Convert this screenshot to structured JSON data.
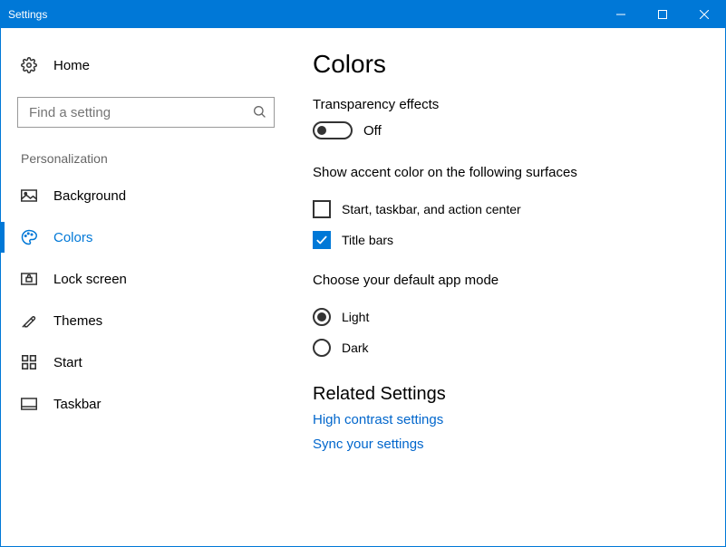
{
  "window": {
    "title": "Settings"
  },
  "sidebar": {
    "home_label": "Home",
    "search_placeholder": "Find a setting",
    "section_label": "Personalization",
    "items": [
      {
        "label": "Background",
        "active": false
      },
      {
        "label": "Colors",
        "active": true
      },
      {
        "label": "Lock screen",
        "active": false
      },
      {
        "label": "Themes",
        "active": false
      },
      {
        "label": "Start",
        "active": false
      },
      {
        "label": "Taskbar",
        "active": false
      }
    ]
  },
  "main": {
    "title": "Colors",
    "transparency": {
      "label": "Transparency effects",
      "state_text": "Off",
      "on": false
    },
    "accent": {
      "label": "Show accent color on the following surfaces",
      "options": [
        {
          "label": "Start, taskbar, and action center",
          "checked": false
        },
        {
          "label": "Title bars",
          "checked": true
        }
      ]
    },
    "app_mode": {
      "label": "Choose your default app mode",
      "options": [
        {
          "label": "Light",
          "selected": true
        },
        {
          "label": "Dark",
          "selected": false
        }
      ]
    },
    "related": {
      "heading": "Related Settings",
      "links": [
        "High contrast settings",
        "Sync your settings"
      ]
    }
  }
}
